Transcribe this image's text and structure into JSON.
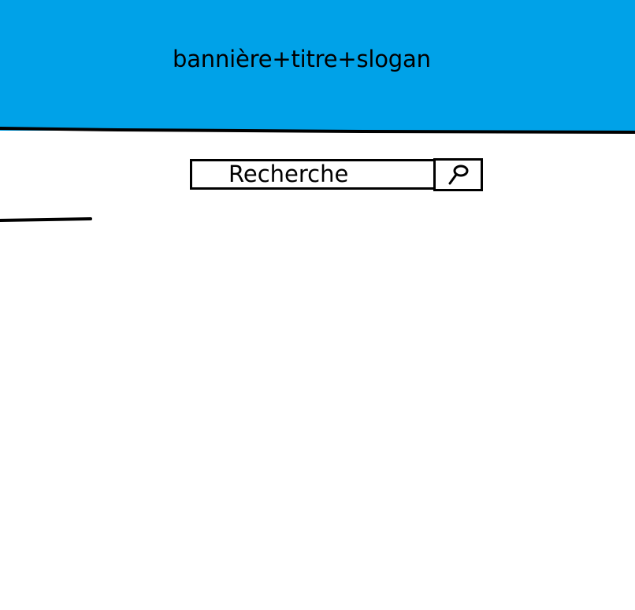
{
  "banner": {
    "text": "bannière+titre+slogan",
    "background_color": "#00a2e8"
  },
  "search": {
    "placeholder": "Recherche",
    "button_icon": "search-icon"
  }
}
